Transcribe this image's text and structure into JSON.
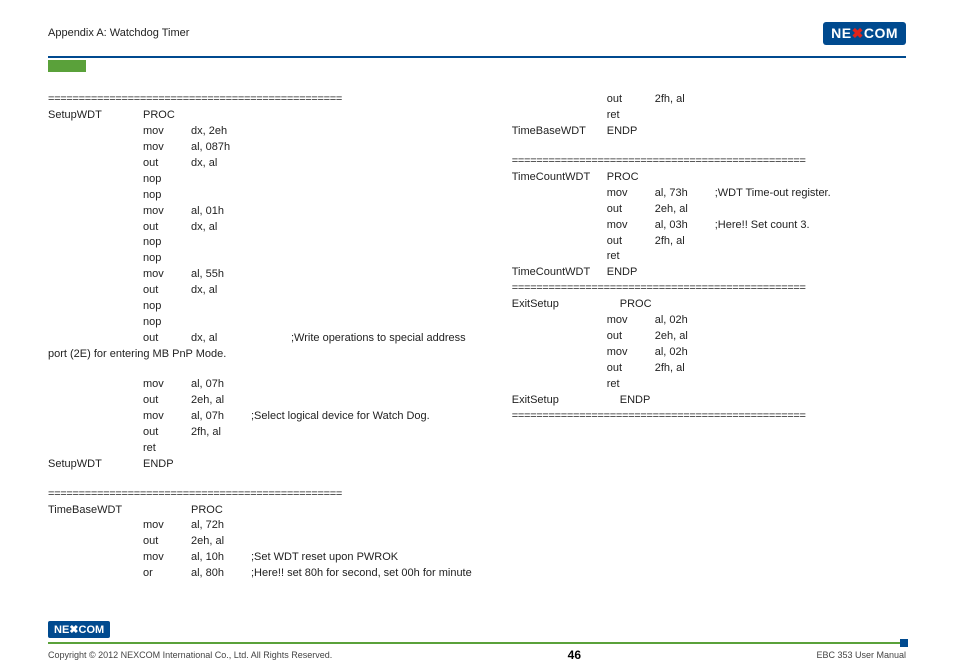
{
  "header": {
    "title": "Appendix A: Watchdog Timer",
    "logo": "NEXCOM"
  },
  "sep": "================================================",
  "left": {
    "block1": {
      "label_start": "SetupWDT",
      "proc": "PROC",
      "lines": [
        {
          "label": "",
          "op": "mov",
          "arg": "dx, 2eh",
          "cmt": ""
        },
        {
          "label": "",
          "op": "mov",
          "arg": "al, 087h",
          "cmt": ""
        },
        {
          "label": "",
          "op": "out",
          "arg": "dx, al",
          "cmt": ""
        },
        {
          "label": "",
          "op": "nop",
          "arg": "",
          "cmt": ""
        },
        {
          "label": "",
          "op": "nop",
          "arg": "",
          "cmt": ""
        },
        {
          "label": "",
          "op": "mov",
          "arg": "al, 01h",
          "cmt": ""
        },
        {
          "label": "",
          "op": "out",
          "arg": "dx, al",
          "cmt": ""
        },
        {
          "label": "",
          "op": "nop",
          "arg": "",
          "cmt": ""
        },
        {
          "label": "",
          "op": "nop",
          "arg": "",
          "cmt": ""
        },
        {
          "label": "",
          "op": "mov",
          "arg": "al, 55h",
          "cmt": ""
        },
        {
          "label": "",
          "op": "out",
          "arg": "dx, al",
          "cmt": ""
        },
        {
          "label": "",
          "op": "nop",
          "arg": "",
          "cmt": ""
        },
        {
          "label": "",
          "op": "nop",
          "arg": "",
          "cmt": ""
        }
      ],
      "wrapline_pre": "out",
      "wrapline_arg": "dx, al",
      "wrapline_cmt": ";Write   operations   to   special   address",
      "wrapline2": "port (2E) for entering MB PnP Mode.",
      "lines2": [
        {
          "label": "",
          "op": "mov",
          "arg": "al, 07h",
          "cmt": ""
        },
        {
          "label": "",
          "op": "out",
          "arg": "2eh, al",
          "cmt": ""
        },
        {
          "label": "",
          "op": "mov",
          "arg": "al, 07h",
          "cmt": ";Select logical device for Watch Dog."
        },
        {
          "label": "",
          "op": "out",
          "arg": "2fh, al",
          "cmt": ""
        },
        {
          "label": "",
          "op": "ret",
          "arg": "",
          "cmt": ""
        }
      ],
      "label_end": "SetupWDT",
      "endp": "ENDP"
    },
    "block2": {
      "label_start": "TimeBaseWDT",
      "proc": "PROC",
      "lines": [
        {
          "label": "",
          "op": "mov",
          "arg": "al, 72h",
          "cmt": ""
        },
        {
          "label": "",
          "op": "out",
          "arg": "2eh, al",
          "cmt": ""
        },
        {
          "label": "",
          "op": "mov",
          "arg": "al, 10h",
          "cmt": ";Set WDT reset upon PWROK"
        },
        {
          "label": "",
          "op": "or",
          "arg": "al, 80h",
          "cmt": ";Here!! set 80h for second, set 00h for minute"
        }
      ]
    }
  },
  "right": {
    "pre": [
      {
        "label": "",
        "op": "out",
        "arg": "2fh, al",
        "cmt": ""
      },
      {
        "label": "",
        "op": "ret",
        "arg": "",
        "cmt": ""
      }
    ],
    "tb_end_label": "TimeBaseWDT",
    "tb_end": "ENDP",
    "tc": {
      "label_start": "TimeCountWDT",
      "proc": "PROC",
      "lines": [
        {
          "label": "",
          "op": "mov",
          "arg": "al, 73h",
          "cmt": ";WDT Time-out register."
        },
        {
          "label": "",
          "op": "out",
          "arg": "2eh, al",
          "cmt": ""
        },
        {
          "label": "",
          "op": "mov",
          "arg": "al, 03h",
          "cmt": ";Here!! Set count 3."
        },
        {
          "label": "",
          "op": "out",
          "arg": "2fh, al",
          "cmt": ""
        },
        {
          "label": "",
          "op": "ret",
          "arg": "",
          "cmt": ""
        }
      ],
      "label_end": "TimeCountWDT",
      "endp": "ENDP"
    },
    "ex": {
      "label_start": "ExitSetup",
      "proc": "PROC",
      "lines": [
        {
          "label": "",
          "op": "mov",
          "arg": "al, 02h",
          "cmt": ""
        },
        {
          "label": "",
          "op": "out",
          "arg": "2eh, al",
          "cmt": ""
        },
        {
          "label": "",
          "op": "mov",
          "arg": "al, 02h",
          "cmt": ""
        },
        {
          "label": "",
          "op": "out",
          "arg": "2fh, al",
          "cmt": ""
        },
        {
          "label": "",
          "op": "ret",
          "arg": "",
          "cmt": ""
        }
      ],
      "label_end": "ExitSetup",
      "endp": "ENDP"
    }
  },
  "footer": {
    "logo": "NEXCOM",
    "copyright": "Copyright © 2012 NEXCOM International Co., Ltd. All Rights Reserved.",
    "page": "46",
    "manual": "EBC 353 User Manual"
  }
}
